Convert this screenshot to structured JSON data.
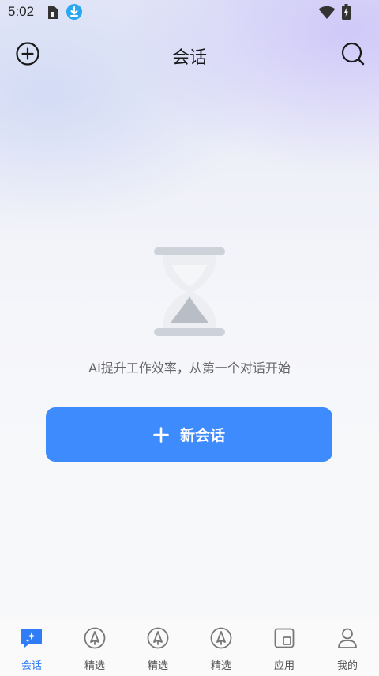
{
  "status_bar": {
    "time": "5:02"
  },
  "header": {
    "title": "会话"
  },
  "empty_state": {
    "text": "AI提升工作效率，从第一个对话开始",
    "button_label": "新会话"
  },
  "bottom_nav": {
    "items": [
      {
        "label": "会话",
        "icon": "chat-sparkle-icon",
        "active": true
      },
      {
        "label": "精选",
        "icon": "pen-nib-icon",
        "active": false
      },
      {
        "label": "精选",
        "icon": "pen-nib-icon",
        "active": false
      },
      {
        "label": "精选",
        "icon": "pen-nib-icon",
        "active": false
      },
      {
        "label": "应用",
        "icon": "apps-icon",
        "active": false
      },
      {
        "label": "我的",
        "icon": "person-icon",
        "active": false
      }
    ]
  },
  "colors": {
    "accent": "#3d8bfd",
    "active_nav": "#2f7cf6"
  }
}
